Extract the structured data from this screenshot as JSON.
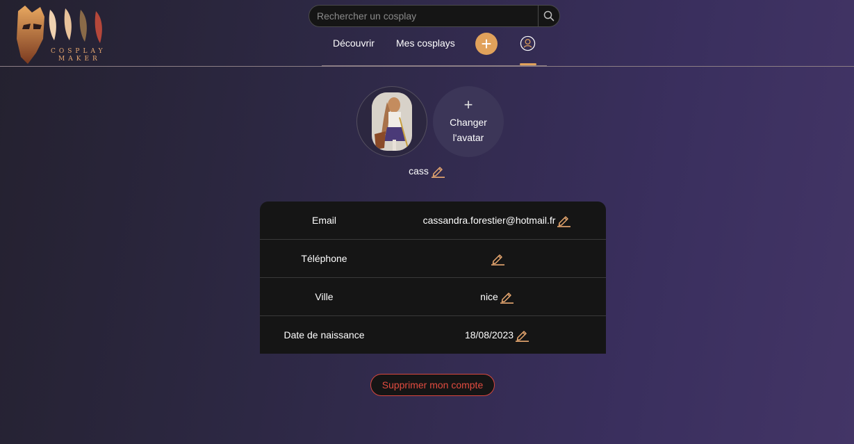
{
  "brand": {
    "line1": "COSPLAY",
    "line2": "MAKER"
  },
  "search": {
    "placeholder": "Rechercher un cosplay",
    "icon": "search-icon"
  },
  "nav": {
    "items": [
      {
        "label": "Découvrir"
      },
      {
        "label": "Mes cosplays"
      }
    ],
    "add_label": "+",
    "accent": "#e1a25b"
  },
  "profile": {
    "change_avatar_plus": "+",
    "change_avatar_label": "Changer l'avatar",
    "username": "cass"
  },
  "info": {
    "rows": [
      {
        "label": "Email",
        "value": "cassandra.forestier@hotmail.fr"
      },
      {
        "label": "Téléphone",
        "value": ""
      },
      {
        "label": "Ville",
        "value": "nice"
      },
      {
        "label": "Date de naissance",
        "value": "18/08/2023"
      }
    ]
  },
  "actions": {
    "delete_label": "Supprimer mon compte",
    "delete_color": "#e24c40"
  }
}
